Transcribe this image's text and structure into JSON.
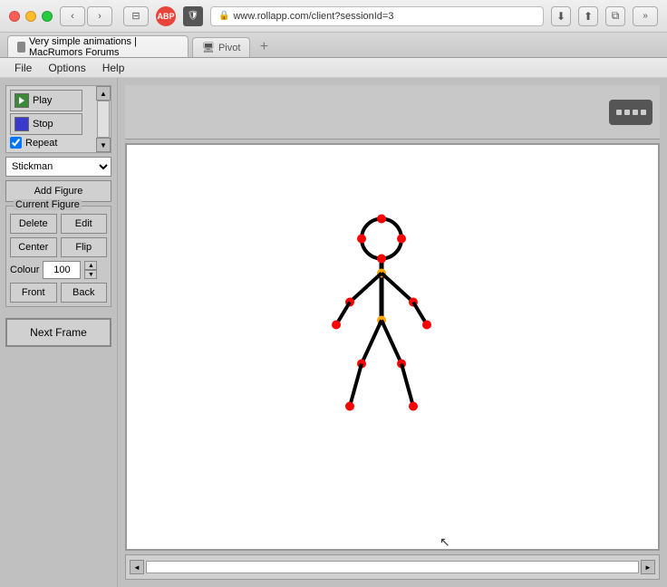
{
  "browser": {
    "url": "www.rollapp.com/client?sessionId=3",
    "tab_main_label": "Very simple animations | MacRumors Forums",
    "tab_pivot_label": "Pivot",
    "nav_back": "‹",
    "nav_forward": "›"
  },
  "menubar": {
    "file": "File",
    "options": "Options",
    "help": "Help"
  },
  "sidebar": {
    "play_label": "Play",
    "stop_label": "Stop",
    "repeat_label": "Repeat",
    "figure_select_value": "Stickman",
    "add_figure_label": "Add Figure",
    "current_figure_group_label": "Current Figure",
    "delete_label": "Delete",
    "edit_label": "Edit",
    "center_label": "Center",
    "flip_label": "Flip",
    "colour_label": "Colour",
    "colour_value": "100",
    "front_label": "Front",
    "back_label": "Back",
    "next_frame_label": "Next Frame"
  },
  "canvas": {
    "bg": "white"
  }
}
